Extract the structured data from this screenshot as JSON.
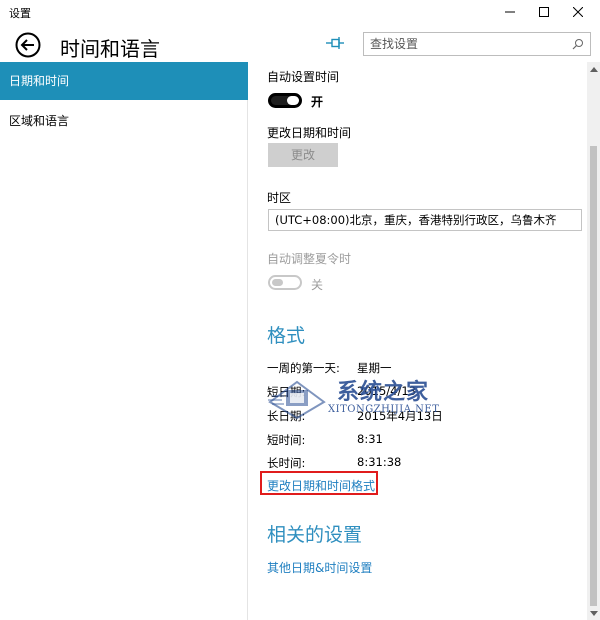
{
  "window": {
    "title": "设置"
  },
  "header": {
    "page_title": "时间和语言",
    "search_placeholder": "查找设置"
  },
  "sidebar": {
    "items": [
      {
        "label": "日期和时间",
        "active": true
      },
      {
        "label": "区域和语言",
        "active": false
      }
    ]
  },
  "main": {
    "auto_time": {
      "label": "自动设置时间",
      "toggle_state": "开",
      "on": true
    },
    "change_datetime": {
      "label": "更改日期和时间",
      "button": "更改",
      "enabled": false
    },
    "timezone": {
      "label": "时区",
      "value": "(UTC+08:00)北京，重庆，香港特别行政区，乌鲁木齐"
    },
    "dst": {
      "label": "自动调整夏令时",
      "toggle_state": "关",
      "on": false,
      "enabled": false
    },
    "format": {
      "title": "格式",
      "rows": [
        {
          "key": "一周的第一天:",
          "value": "星期一"
        },
        {
          "key": "短日期:",
          "value": "2015/4/13"
        },
        {
          "key": "长日期:",
          "value": "2015年4月13日"
        },
        {
          "key": "短时间:",
          "value": "8:31"
        },
        {
          "key": "长时间:",
          "value": "8:31:38"
        }
      ],
      "change_link": "更改日期和时间格式"
    },
    "related": {
      "title": "相关的设置",
      "link": "其他日期&时间设置"
    }
  },
  "watermark": {
    "text": "系统之家",
    "sub": "XITONGZHIJIA.NET"
  },
  "colors": {
    "accent": "#1e8fb8",
    "link": "#1f7fc0",
    "section": "#2f8fbf",
    "highlight": "#e01c1c"
  }
}
